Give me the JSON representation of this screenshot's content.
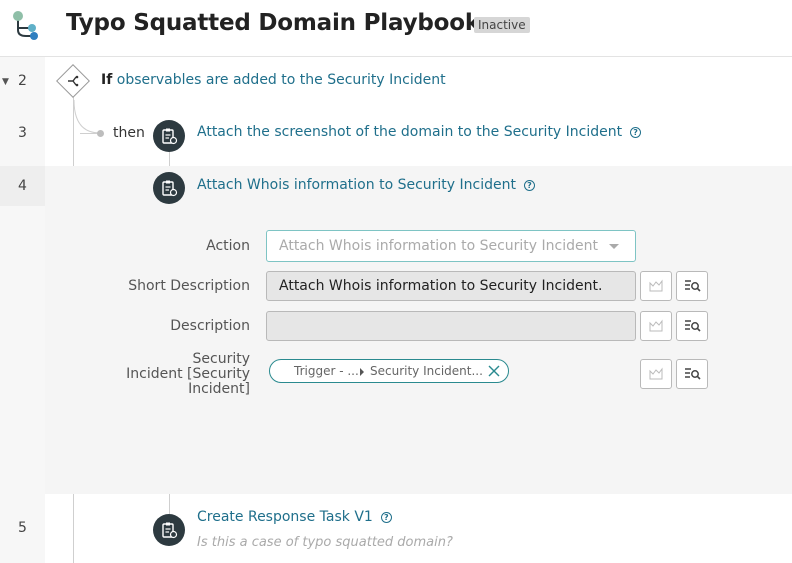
{
  "header": {
    "title": "Typo Squatted Domain Playbook",
    "status_badge": "Inactive"
  },
  "rows": [
    {
      "number": "2"
    },
    {
      "number": "3"
    },
    {
      "number": "4"
    },
    {
      "number": "5"
    }
  ],
  "condition": {
    "keyword": "If",
    "text": "observables are added to the Security Incident"
  },
  "connector": {
    "then_label": "then"
  },
  "steps": [
    {
      "title": "Attach the screenshot of the domain to the Security Incident"
    },
    {
      "title": "Attach Whois information to Security Incident"
    },
    {
      "title": "Create Response Task V1",
      "question": "Is this a case of typo squatted domain?"
    }
  ],
  "form": {
    "action": {
      "label": "Action",
      "value": "Attach Whois information to Security Incident"
    },
    "short_description": {
      "label": "Short Description",
      "value": "Attach Whois information to Security Incident."
    },
    "description": {
      "label": "Description",
      "value": ""
    },
    "security_incident": {
      "label_line1": "Security",
      "label_line2": "Incident [Security",
      "label_line3": "Incident]",
      "pill_part1": "Trigger - ...",
      "pill_part2": "Security Incident..."
    }
  },
  "colors": {
    "accent": "#1f6f8b",
    "step_icon_bg": "#2d3a40",
    "pill_border": "#2a8a8f"
  }
}
